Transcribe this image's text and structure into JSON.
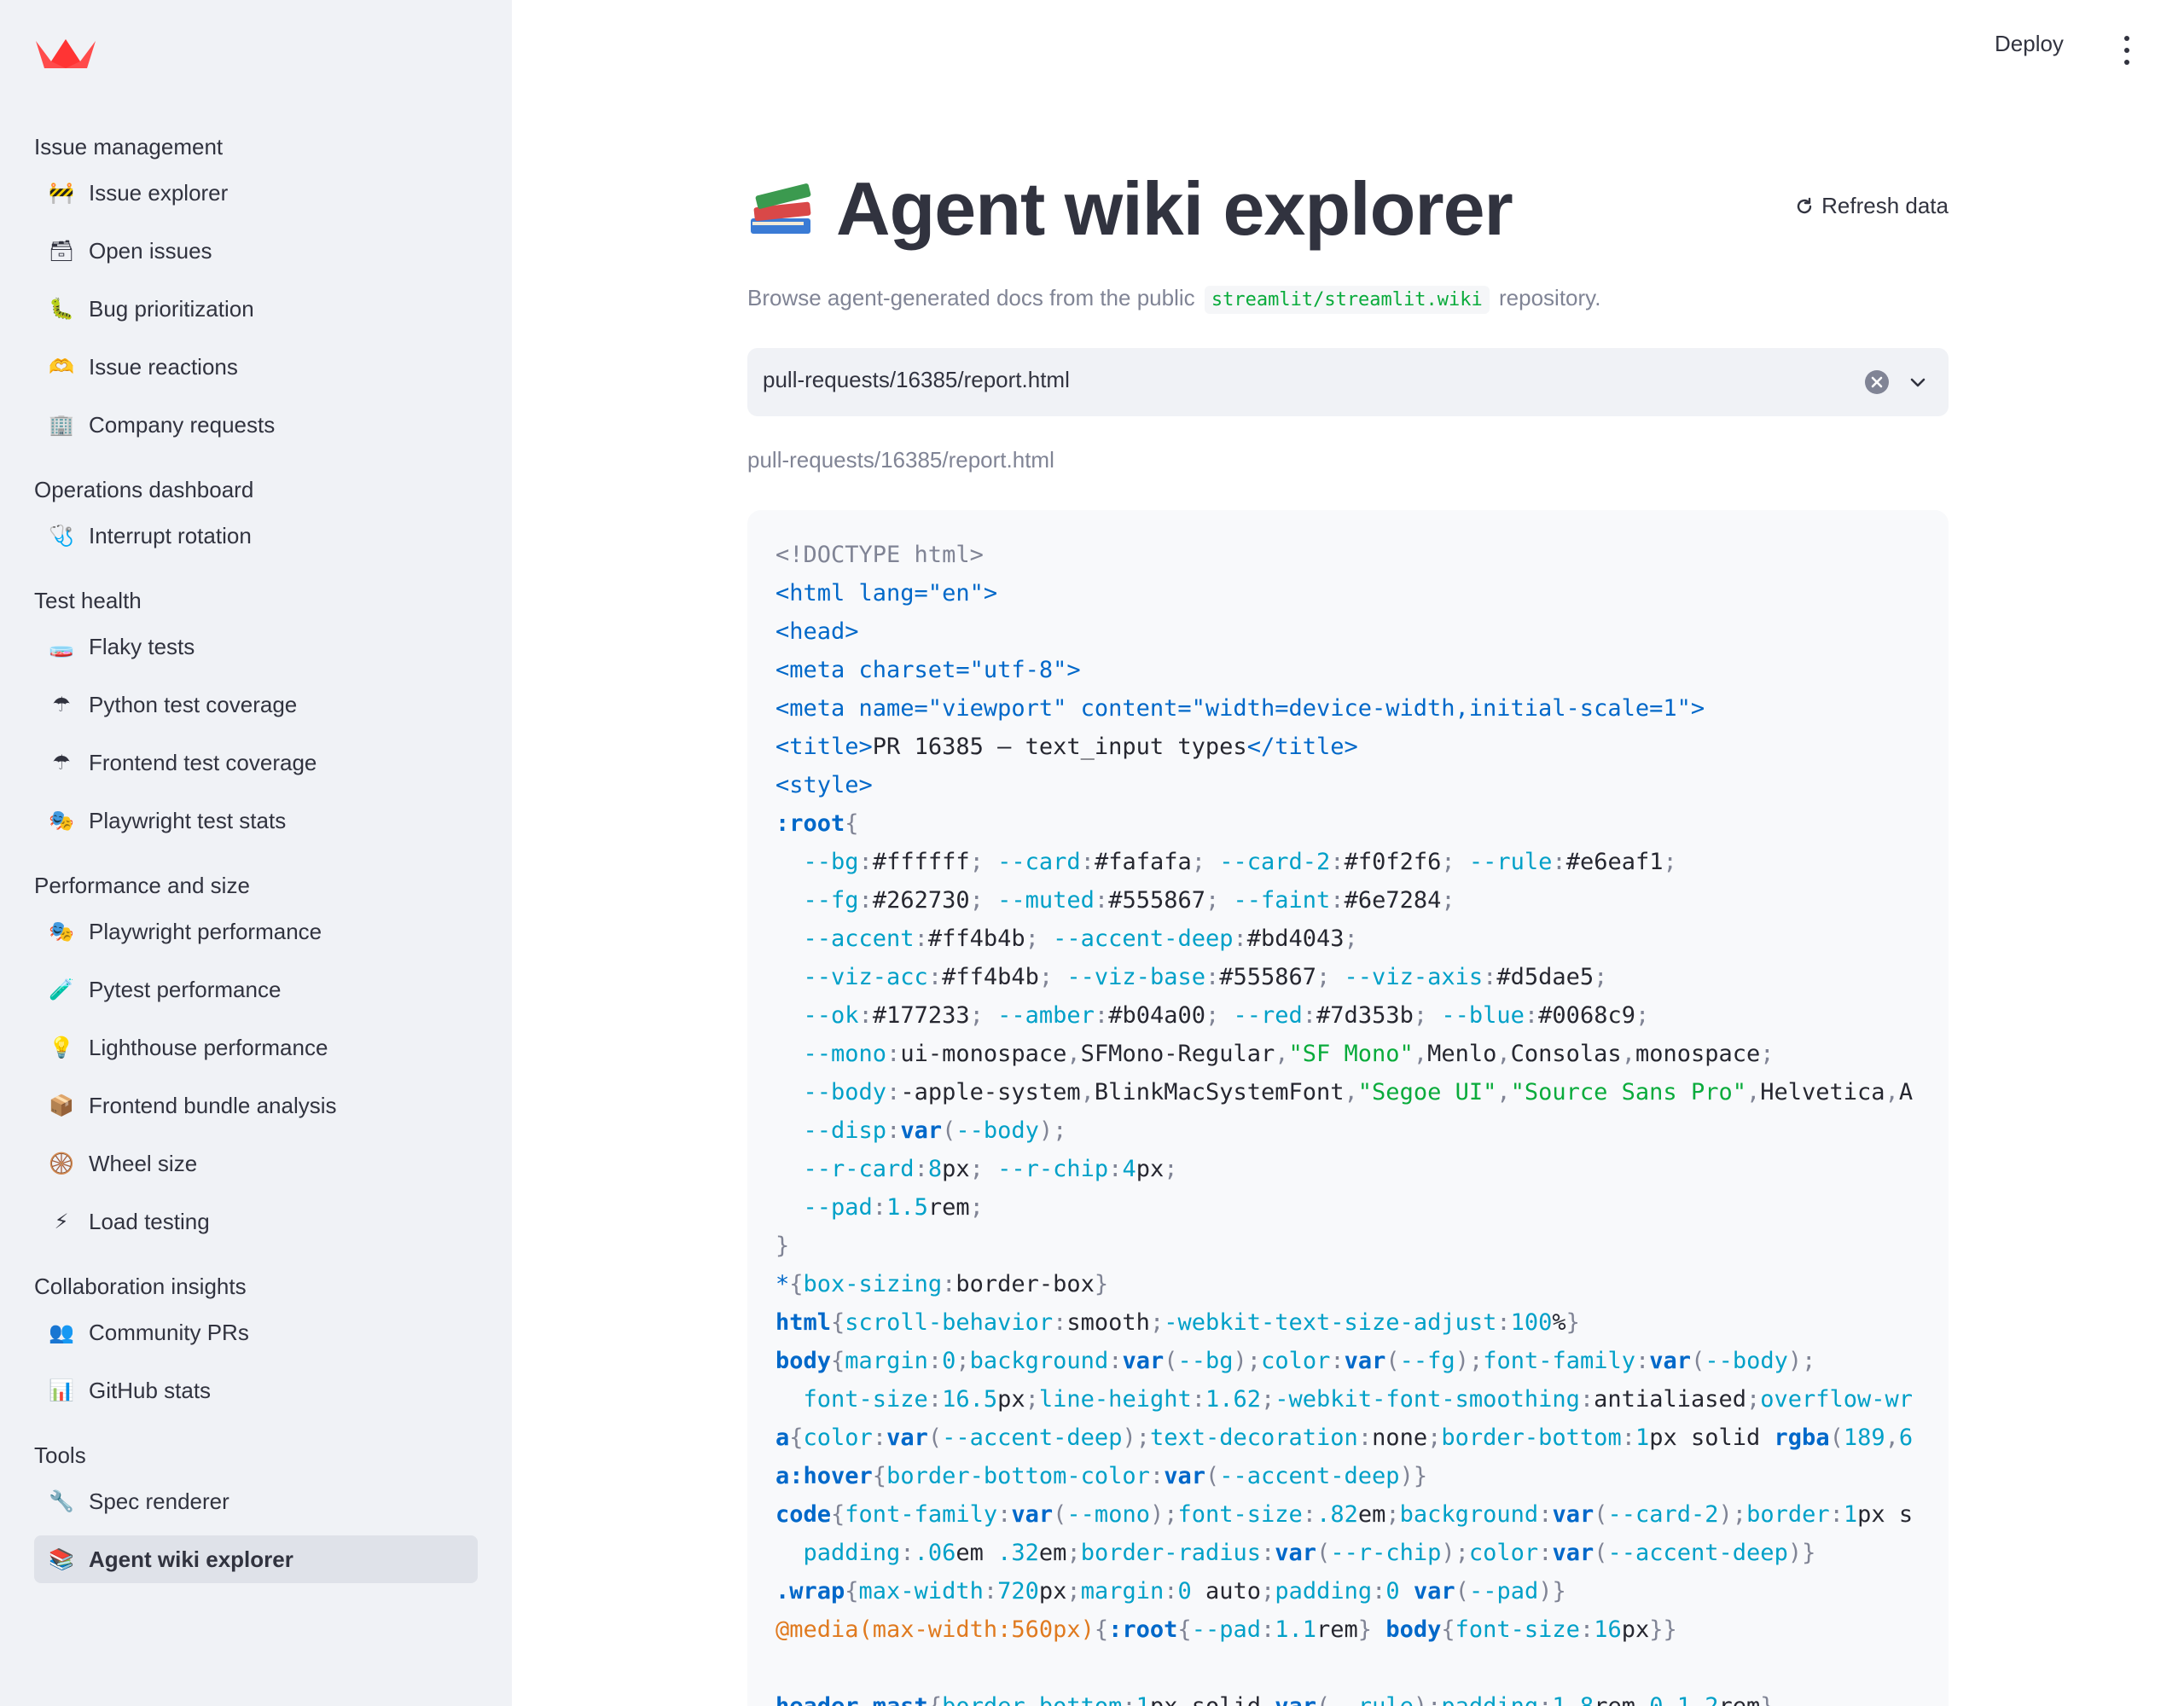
{
  "sidebar": {
    "sections": [
      {
        "header": "Issue management",
        "items": [
          {
            "icon": "construction-icon",
            "glyph": "🚧",
            "label": "Issue explorer"
          },
          {
            "icon": "card-file-icon",
            "glyph": "🗃",
            "label": "Open issues"
          },
          {
            "icon": "bug-icon",
            "glyph": "🐛",
            "label": "Bug prioritization"
          },
          {
            "icon": "raised-hands-icon",
            "glyph": "🫶",
            "label": "Issue reactions"
          },
          {
            "icon": "office-building-icon",
            "glyph": "🏢",
            "label": "Company requests"
          }
        ]
      },
      {
        "header": "Operations dashboard",
        "items": [
          {
            "icon": "stethoscope-icon",
            "glyph": "🩺",
            "label": "Interrupt rotation"
          }
        ]
      },
      {
        "header": "Test health",
        "items": [
          {
            "icon": "test-tube-icon",
            "glyph": "🧫",
            "label": "Flaky tests"
          },
          {
            "icon": "umbrella-icon",
            "glyph": "☂",
            "label": "Python test coverage"
          },
          {
            "icon": "umbrella-icon",
            "glyph": "☂",
            "label": "Frontend test coverage"
          },
          {
            "icon": "theater-masks-icon",
            "glyph": "🎭",
            "label": "Playwright test stats"
          }
        ]
      },
      {
        "header": "Performance and size",
        "items": [
          {
            "icon": "theater-masks-icon",
            "glyph": "🎭",
            "label": "Playwright performance"
          },
          {
            "icon": "test-tube-icon",
            "glyph": "🧪",
            "label": "Pytest performance"
          },
          {
            "icon": "light-bulb-icon",
            "glyph": "💡",
            "label": "Lighthouse performance"
          },
          {
            "icon": "package-icon",
            "glyph": "📦",
            "label": "Frontend bundle analysis"
          },
          {
            "icon": "wheel-icon",
            "glyph": "🛞",
            "label": "Wheel size"
          },
          {
            "icon": "lightning-icon",
            "glyph": "⚡",
            "label": "Load testing"
          }
        ]
      },
      {
        "header": "Collaboration insights",
        "items": [
          {
            "icon": "people-icon",
            "glyph": "👥",
            "label": "Community PRs"
          },
          {
            "icon": "bar-chart-icon",
            "glyph": "📊",
            "label": "GitHub stats"
          }
        ]
      },
      {
        "header": "Tools",
        "items": [
          {
            "icon": "wrench-icon",
            "glyph": "🔧",
            "label": "Spec renderer"
          },
          {
            "icon": "books-icon",
            "glyph": "📚",
            "label": "Agent wiki explorer",
            "active": true
          }
        ]
      }
    ]
  },
  "header": {
    "deploy_label": "Deploy"
  },
  "main": {
    "title": "Agent wiki explorer",
    "title_icon": "books-icon",
    "refresh_label": "Refresh data",
    "caption_before": "Browse agent-generated docs from the public",
    "caption_code": "streamlit/streamlit.wiki",
    "caption_after": "repository.",
    "select_value": "pull-requests/16385/report.html",
    "path_label": "pull-requests/16385/report.html"
  },
  "code_lines": [
    [
      [
        "c",
        "<!DOCTYPE html>"
      ]
    ],
    [
      [
        "t",
        "<html lang=\"en\">"
      ]
    ],
    [
      [
        "t",
        "<head>"
      ]
    ],
    [
      [
        "t",
        "<meta charset=\"utf-8\">"
      ]
    ],
    [
      [
        "t",
        "<meta name=\"viewport\" content=\"width=device-width,initial-scale=1\">"
      ]
    ],
    [
      [
        "t",
        "<title>"
      ],
      [
        "x",
        "PR 16385 — text_input types"
      ],
      [
        "t",
        "</title>"
      ]
    ],
    [
      [
        "t",
        "<style>"
      ]
    ],
    [
      [
        "k",
        ":root"
      ],
      [
        "c",
        "{"
      ]
    ],
    [
      [
        "x",
        "  "
      ],
      [
        "p",
        "--bg"
      ],
      [
        "c",
        ":"
      ],
      [
        "x",
        "#ffffff"
      ],
      [
        "c",
        "; "
      ],
      [
        "p",
        "--card"
      ],
      [
        "c",
        ":"
      ],
      [
        "x",
        "#fafafa"
      ],
      [
        "c",
        "; "
      ],
      [
        "p",
        "--card-2"
      ],
      [
        "c",
        ":"
      ],
      [
        "x",
        "#f0f2f6"
      ],
      [
        "c",
        "; "
      ],
      [
        "p",
        "--rule"
      ],
      [
        "c",
        ":"
      ],
      [
        "x",
        "#e6eaf1"
      ],
      [
        "c",
        ";"
      ]
    ],
    [
      [
        "x",
        "  "
      ],
      [
        "p",
        "--fg"
      ],
      [
        "c",
        ":"
      ],
      [
        "x",
        "#262730"
      ],
      [
        "c",
        "; "
      ],
      [
        "p",
        "--muted"
      ],
      [
        "c",
        ":"
      ],
      [
        "x",
        "#555867"
      ],
      [
        "c",
        "; "
      ],
      [
        "p",
        "--faint"
      ],
      [
        "c",
        ":"
      ],
      [
        "x",
        "#6e7284"
      ],
      [
        "c",
        ";"
      ]
    ],
    [
      [
        "x",
        "  "
      ],
      [
        "p",
        "--accent"
      ],
      [
        "c",
        ":"
      ],
      [
        "x",
        "#ff4b4b"
      ],
      [
        "c",
        "; "
      ],
      [
        "p",
        "--accent-deep"
      ],
      [
        "c",
        ":"
      ],
      [
        "x",
        "#bd4043"
      ],
      [
        "c",
        ";"
      ]
    ],
    [
      [
        "x",
        "  "
      ],
      [
        "p",
        "--viz-acc"
      ],
      [
        "c",
        ":"
      ],
      [
        "x",
        "#ff4b4b"
      ],
      [
        "c",
        "; "
      ],
      [
        "p",
        "--viz-base"
      ],
      [
        "c",
        ":"
      ],
      [
        "x",
        "#555867"
      ],
      [
        "c",
        "; "
      ],
      [
        "p",
        "--viz-axis"
      ],
      [
        "c",
        ":"
      ],
      [
        "x",
        "#d5dae5"
      ],
      [
        "c",
        ";"
      ]
    ],
    [
      [
        "x",
        "  "
      ],
      [
        "p",
        "--ok"
      ],
      [
        "c",
        ":"
      ],
      [
        "x",
        "#177233"
      ],
      [
        "c",
        "; "
      ],
      [
        "p",
        "--amber"
      ],
      [
        "c",
        ":"
      ],
      [
        "x",
        "#b04a00"
      ],
      [
        "c",
        "; "
      ],
      [
        "p",
        "--red"
      ],
      [
        "c",
        ":"
      ],
      [
        "x",
        "#7d353b"
      ],
      [
        "c",
        "; "
      ],
      [
        "p",
        "--blue"
      ],
      [
        "c",
        ":"
      ],
      [
        "x",
        "#0068c9"
      ],
      [
        "c",
        ";"
      ]
    ],
    [
      [
        "x",
        "  "
      ],
      [
        "p",
        "--mono"
      ],
      [
        "c",
        ":"
      ],
      [
        "x",
        "ui-monospace"
      ],
      [
        "c",
        ","
      ],
      [
        "x",
        "SFMono-Regular"
      ],
      [
        "c",
        ","
      ],
      [
        "s",
        "\"SF Mono\""
      ],
      [
        "c",
        ","
      ],
      [
        "x",
        "Menlo"
      ],
      [
        "c",
        ","
      ],
      [
        "x",
        "Consolas"
      ],
      [
        "c",
        ","
      ],
      [
        "x",
        "monospace"
      ],
      [
        "c",
        ";"
      ]
    ],
    [
      [
        "x",
        "  "
      ],
      [
        "p",
        "--body"
      ],
      [
        "c",
        ":"
      ],
      [
        "x",
        "-apple-system"
      ],
      [
        "c",
        ","
      ],
      [
        "x",
        "BlinkMacSystemFont"
      ],
      [
        "c",
        ","
      ],
      [
        "s",
        "\"Segoe UI\""
      ],
      [
        "c",
        ","
      ],
      [
        "s",
        "\"Source Sans Pro\""
      ],
      [
        "c",
        ","
      ],
      [
        "x",
        "Helvetica"
      ],
      [
        "c",
        ","
      ],
      [
        "x",
        "A"
      ]
    ],
    [
      [
        "x",
        "  "
      ],
      [
        "p",
        "--disp"
      ],
      [
        "c",
        ":"
      ],
      [
        "k",
        "var"
      ],
      [
        "c",
        "("
      ],
      [
        "p",
        "--body"
      ],
      [
        "c",
        ");"
      ]
    ],
    [
      [
        "x",
        "  "
      ],
      [
        "p",
        "--r-card"
      ],
      [
        "c",
        ":"
      ],
      [
        "n",
        "8"
      ],
      [
        "x",
        "px"
      ],
      [
        "c",
        "; "
      ],
      [
        "p",
        "--r-chip"
      ],
      [
        "c",
        ":"
      ],
      [
        "n",
        "4"
      ],
      [
        "x",
        "px"
      ],
      [
        "c",
        ";"
      ]
    ],
    [
      [
        "x",
        "  "
      ],
      [
        "p",
        "--pad"
      ],
      [
        "c",
        ":"
      ],
      [
        "n",
        "1.5"
      ],
      [
        "x",
        "rem"
      ],
      [
        "c",
        ";"
      ]
    ],
    [
      [
        "c",
        "}"
      ]
    ],
    [
      [
        "t",
        "*"
      ],
      [
        "c",
        "{"
      ],
      [
        "p",
        "box-sizing"
      ],
      [
        "c",
        ":"
      ],
      [
        "x",
        "border-box"
      ],
      [
        "c",
        "}"
      ]
    ],
    [
      [
        "k",
        "html"
      ],
      [
        "c",
        "{"
      ],
      [
        "p",
        "scroll-behavior"
      ],
      [
        "c",
        ":"
      ],
      [
        "x",
        "smooth"
      ],
      [
        "c",
        ";"
      ],
      [
        "p",
        "-webkit-text-size-adjust"
      ],
      [
        "c",
        ":"
      ],
      [
        "n",
        "100"
      ],
      [
        "x",
        "%"
      ],
      [
        "c",
        "}"
      ]
    ],
    [
      [
        "k",
        "body"
      ],
      [
        "c",
        "{"
      ],
      [
        "p",
        "margin"
      ],
      [
        "c",
        ":"
      ],
      [
        "n",
        "0"
      ],
      [
        "c",
        ";"
      ],
      [
        "p",
        "background"
      ],
      [
        "c",
        ":"
      ],
      [
        "k",
        "var"
      ],
      [
        "c",
        "("
      ],
      [
        "p",
        "--bg"
      ],
      [
        "c",
        ");"
      ],
      [
        "p",
        "color"
      ],
      [
        "c",
        ":"
      ],
      [
        "k",
        "var"
      ],
      [
        "c",
        "("
      ],
      [
        "p",
        "--fg"
      ],
      [
        "c",
        ");"
      ],
      [
        "p",
        "font-family"
      ],
      [
        "c",
        ":"
      ],
      [
        "k",
        "var"
      ],
      [
        "c",
        "("
      ],
      [
        "p",
        "--body"
      ],
      [
        "c",
        ");"
      ]
    ],
    [
      [
        "x",
        "  "
      ],
      [
        "p",
        "font-size"
      ],
      [
        "c",
        ":"
      ],
      [
        "n",
        "16.5"
      ],
      [
        "x",
        "px"
      ],
      [
        "c",
        ";"
      ],
      [
        "p",
        "line-height"
      ],
      [
        "c",
        ":"
      ],
      [
        "n",
        "1.62"
      ],
      [
        "c",
        ";"
      ],
      [
        "p",
        "-webkit-font-smoothing"
      ],
      [
        "c",
        ":"
      ],
      [
        "x",
        "antialiased"
      ],
      [
        "c",
        ";"
      ],
      [
        "p",
        "overflow-wr"
      ]
    ],
    [
      [
        "k",
        "a"
      ],
      [
        "c",
        "{"
      ],
      [
        "p",
        "color"
      ],
      [
        "c",
        ":"
      ],
      [
        "k",
        "var"
      ],
      [
        "c",
        "("
      ],
      [
        "p",
        "--accent-deep"
      ],
      [
        "c",
        ");"
      ],
      [
        "p",
        "text-decoration"
      ],
      [
        "c",
        ":"
      ],
      [
        "x",
        "none"
      ],
      [
        "c",
        ";"
      ],
      [
        "p",
        "border-bottom"
      ],
      [
        "c",
        ":"
      ],
      [
        "n",
        "1"
      ],
      [
        "x",
        "px solid "
      ],
      [
        "k",
        "rgba"
      ],
      [
        "c",
        "("
      ],
      [
        "n",
        "189"
      ],
      [
        "c",
        ","
      ],
      [
        "n",
        "6"
      ]
    ],
    [
      [
        "k",
        "a:hover"
      ],
      [
        "c",
        "{"
      ],
      [
        "p",
        "border-bottom-color"
      ],
      [
        "c",
        ":"
      ],
      [
        "k",
        "var"
      ],
      [
        "c",
        "("
      ],
      [
        "p",
        "--accent-deep"
      ],
      [
        "c",
        ")}"
      ]
    ],
    [
      [
        "k",
        "code"
      ],
      [
        "c",
        "{"
      ],
      [
        "p",
        "font-family"
      ],
      [
        "c",
        ":"
      ],
      [
        "k",
        "var"
      ],
      [
        "c",
        "("
      ],
      [
        "p",
        "--mono"
      ],
      [
        "c",
        ");"
      ],
      [
        "p",
        "font-size"
      ],
      [
        "c",
        ":"
      ],
      [
        "n",
        ".82"
      ],
      [
        "x",
        "em"
      ],
      [
        "c",
        ";"
      ],
      [
        "p",
        "background"
      ],
      [
        "c",
        ":"
      ],
      [
        "k",
        "var"
      ],
      [
        "c",
        "("
      ],
      [
        "p",
        "--card-2"
      ],
      [
        "c",
        ");"
      ],
      [
        "p",
        "border"
      ],
      [
        "c",
        ":"
      ],
      [
        "n",
        "1"
      ],
      [
        "x",
        "px s"
      ]
    ],
    [
      [
        "x",
        "  "
      ],
      [
        "p",
        "padding"
      ],
      [
        "c",
        ":"
      ],
      [
        "n",
        ".06"
      ],
      [
        "x",
        "em "
      ],
      [
        "n",
        ".32"
      ],
      [
        "x",
        "em"
      ],
      [
        "c",
        ";"
      ],
      [
        "p",
        "border-radius"
      ],
      [
        "c",
        ":"
      ],
      [
        "k",
        "var"
      ],
      [
        "c",
        "("
      ],
      [
        "p",
        "--r-chip"
      ],
      [
        "c",
        ");"
      ],
      [
        "p",
        "color"
      ],
      [
        "c",
        ":"
      ],
      [
        "k",
        "var"
      ],
      [
        "c",
        "("
      ],
      [
        "p",
        "--accent-deep"
      ],
      [
        "c",
        ")}"
      ]
    ],
    [
      [
        "k",
        ".wrap"
      ],
      [
        "c",
        "{"
      ],
      [
        "p",
        "max-width"
      ],
      [
        "c",
        ":"
      ],
      [
        "n",
        "720"
      ],
      [
        "x",
        "px"
      ],
      [
        "c",
        ";"
      ],
      [
        "p",
        "margin"
      ],
      [
        "c",
        ":"
      ],
      [
        "n",
        "0"
      ],
      [
        "x",
        " auto"
      ],
      [
        "c",
        ";"
      ],
      [
        "p",
        "padding"
      ],
      [
        "c",
        ":"
      ],
      [
        "n",
        "0"
      ],
      [
        "x",
        " "
      ],
      [
        "k",
        "var"
      ],
      [
        "c",
        "("
      ],
      [
        "p",
        "--pad"
      ],
      [
        "c",
        ")}"
      ]
    ],
    [
      [
        "m",
        "@media(max-width:560px)"
      ],
      [
        "c",
        "{"
      ],
      [
        "k",
        ":root"
      ],
      [
        "c",
        "{"
      ],
      [
        "p",
        "--pad"
      ],
      [
        "c",
        ":"
      ],
      [
        "n",
        "1.1"
      ],
      [
        "x",
        "rem"
      ],
      [
        "c",
        "} "
      ],
      [
        "k",
        "body"
      ],
      [
        "c",
        "{"
      ],
      [
        "p",
        "font-size"
      ],
      [
        "c",
        ":"
      ],
      [
        "n",
        "16"
      ],
      [
        "x",
        "px"
      ],
      [
        "c",
        "}}"
      ]
    ],
    [
      [
        "x",
        ""
      ]
    ],
    [
      [
        "k",
        "header.mast"
      ],
      [
        "c",
        "{"
      ],
      [
        "p",
        "border-bottom"
      ],
      [
        "c",
        ":"
      ],
      [
        "n",
        "1"
      ],
      [
        "x",
        "px solid "
      ],
      [
        "k",
        "var"
      ],
      [
        "c",
        "("
      ],
      [
        "p",
        "--rule"
      ],
      [
        "c",
        ");"
      ],
      [
        "p",
        "padding"
      ],
      [
        "c",
        ":"
      ],
      [
        "n",
        "1.8"
      ],
      [
        "x",
        "rem "
      ],
      [
        "n",
        "0 1.2"
      ],
      [
        "x",
        "rem"
      ],
      [
        "c",
        "}"
      ]
    ]
  ]
}
